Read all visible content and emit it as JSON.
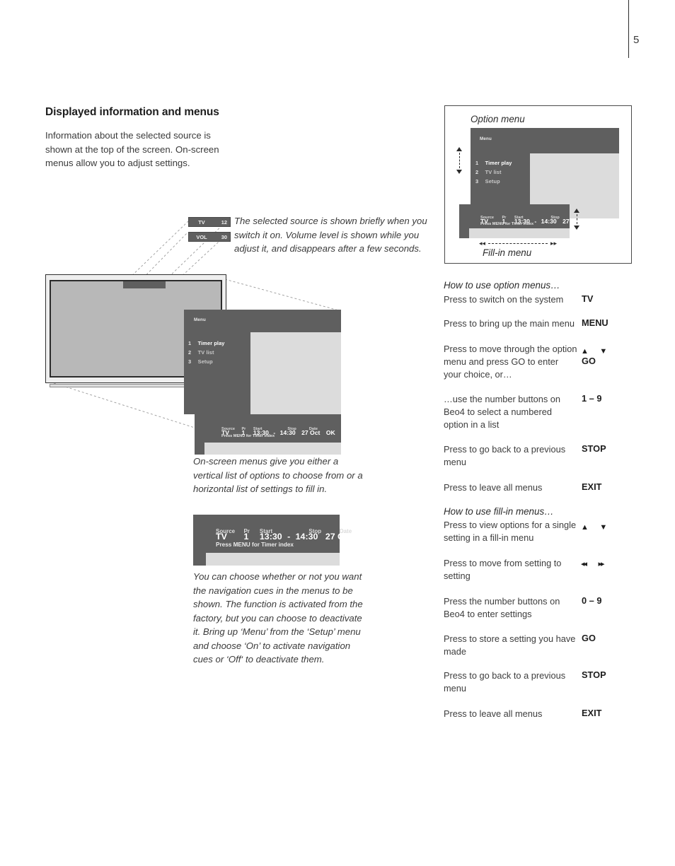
{
  "page": {
    "number": "5"
  },
  "intro": {
    "heading": "Displayed information and menus",
    "paragraph": "Information about the selected source is shown at the top of the screen. On-screen menus allow you to adjust settings."
  },
  "badges": {
    "source": {
      "label": "TV",
      "value": "12"
    },
    "volume": {
      "label": "VOL",
      "value": "30"
    }
  },
  "captions": {
    "badges": "The selected source is shown briefly when you switch it on. Volume level is shown while you adjust it, and disappears after a few seconds.",
    "menus": "On-screen menus give you either a vertical list of options to choose from or a horizontal list of settings to fill in.",
    "navcues": "You can choose whether or not you want the navigation cues in the menus to be shown. The function is activated from the factory, but you can choose to deactivate it. Bring up ‘Menu’ from the ‘Setup’ menu and choose ‘On’ to activate navigation cues or ‘Off‘ to deactivate them."
  },
  "osd_menu": {
    "title": "Menu",
    "items": [
      {
        "num": "1",
        "label": "Timer play",
        "selected": true
      },
      {
        "num": "2",
        "label": "TV list",
        "selected": false
      },
      {
        "num": "3",
        "label": "Setup",
        "selected": false
      }
    ]
  },
  "osd_fill": {
    "headers": [
      "Source",
      "Pr",
      "Start",
      "Stop",
      "Date"
    ],
    "values": {
      "source": "TV",
      "pr": "1",
      "start": "13:30",
      "dash": "-",
      "stop": "14:30",
      "date": "27 Oct",
      "ok": "OK"
    },
    "hint": "Press MENU for Timer index"
  },
  "option_box": {
    "title": "Option menu",
    "footer": "Fill-in menu"
  },
  "how_to_option": {
    "heading": "How to use option menus…",
    "rows": [
      {
        "text": "Press to switch on the system",
        "key": "TV",
        "arrows": null
      },
      {
        "text": "Press to bring up the main menu",
        "key": "MENU",
        "arrows": null
      },
      {
        "text": "Press to move through the option menu and press GO to enter your choice, or…",
        "key": "GO",
        "arrows": "up-down"
      },
      {
        "text": "…use the number buttons on Beo4 to select a numbered option in a list",
        "key": "1 – 9",
        "arrows": null
      },
      {
        "text": "Press to go back to a previous menu",
        "key": "STOP",
        "arrows": null
      },
      {
        "text": "Press to leave all menus",
        "key": "EXIT",
        "arrows": null
      }
    ]
  },
  "how_to_fill": {
    "heading": "How to use fill-in menus…",
    "rows": [
      {
        "text": "Press to view options for a single setting in a fill-in menu",
        "key": "",
        "arrows": "up-down"
      },
      {
        "text": "Press to move from setting to setting",
        "key": "",
        "arrows": "left-right"
      },
      {
        "text": "Press the number buttons on Beo4 to enter settings",
        "key": "0 – 9",
        "arrows": null
      },
      {
        "text": "Press to store a setting you have made",
        "key": "GO",
        "arrows": null
      },
      {
        "text": "Press to go back to a previous menu",
        "key": "STOP",
        "arrows": null
      },
      {
        "text": "Press to leave all menus",
        "key": "EXIT",
        "arrows": null
      }
    ]
  },
  "colors": {
    "osd_dark": "#5f5f5f",
    "osd_light": "#dcdcdc",
    "tv_screen": "#b8b8b8",
    "ink": "#3a3a3a"
  }
}
